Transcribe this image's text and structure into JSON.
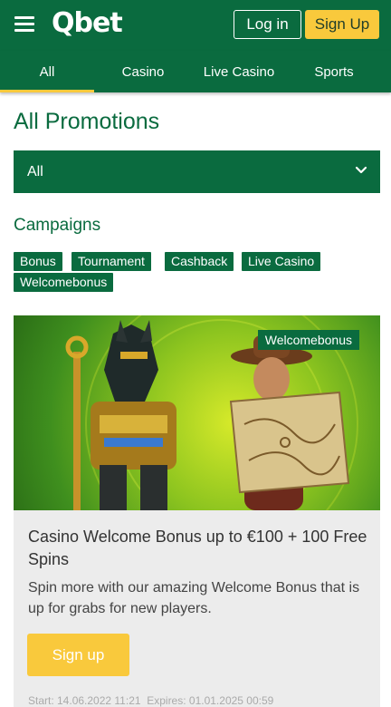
{
  "header": {
    "logo": "Qbet",
    "login_label": "Log in",
    "signup_label": "Sign Up"
  },
  "nav": {
    "tabs": [
      {
        "label": "All",
        "active": true
      },
      {
        "label": "Casino",
        "active": false
      },
      {
        "label": "Live Casino",
        "active": false
      },
      {
        "label": "Sports",
        "active": false
      }
    ]
  },
  "main": {
    "title": "All Promotions",
    "filter": {
      "selected": "All"
    },
    "campaigns_label": "Campaigns",
    "tags": [
      "Bonus",
      "Tournament",
      "Cashback",
      "Live Casino",
      "Welcomebonus"
    ]
  },
  "promo": {
    "badge": "Welcomebonus",
    "title": "Casino Welcome Bonus up to €100 + 100 Free Spins",
    "description": "Spin more with our amazing Welcome Bonus that is up for grabs for new players.",
    "button_label": "Sign up",
    "start": "Start: 14.06.2022 11:21",
    "expires": "Expires: 01.01.2025 00:59"
  },
  "colors": {
    "brand_green": "#0a6b3f",
    "accent_yellow": "#f9c93c",
    "card_bg": "#ececec"
  },
  "icons": {
    "menu": "hamburger-icon",
    "dropdown": "chevron-down-icon"
  }
}
